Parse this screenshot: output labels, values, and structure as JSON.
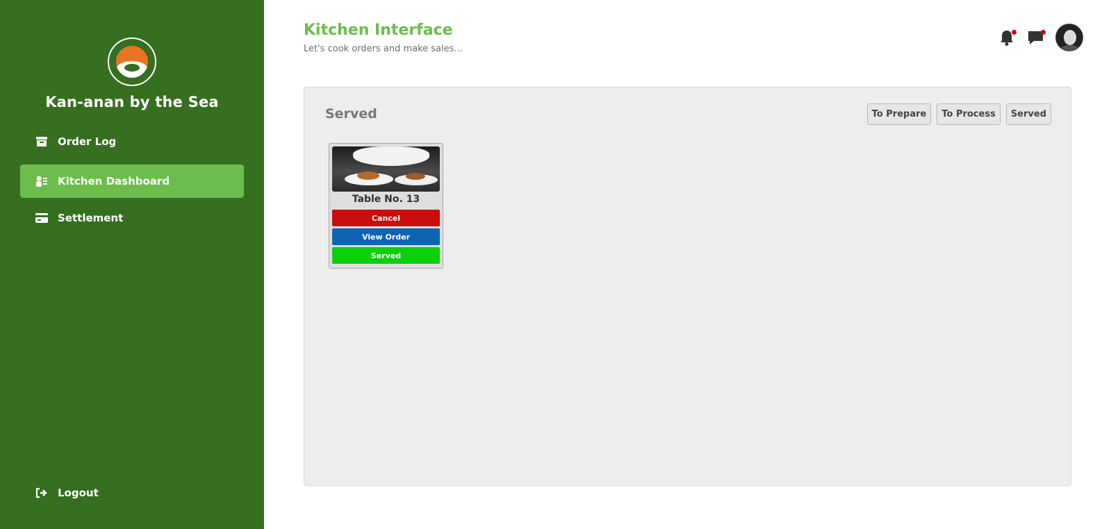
{
  "brand": {
    "name": "Kan-anan by the Sea",
    "logo_icon": "restaurant-logo"
  },
  "sidebar": {
    "items": [
      {
        "label": "Order Log",
        "icon": "archive-icon",
        "active": false
      },
      {
        "label": "Kitchen Dashboard",
        "icon": "chef-list-icon",
        "active": true
      },
      {
        "label": "Settlement",
        "icon": "card-icon",
        "active": false
      }
    ],
    "logout": {
      "label": "Logout",
      "icon": "logout-icon"
    }
  },
  "header": {
    "title": "Kitchen Interface",
    "subtitle": "Let's cook orders and make sales..."
  },
  "panel": {
    "title": "Served",
    "filters": [
      "To Prepare",
      "To Process",
      "Served"
    ]
  },
  "orders": [
    {
      "table": "Table No. 13",
      "actions": {
        "cancel": "Cancel",
        "view": "View Order",
        "served": "Served"
      }
    }
  ],
  "colors": {
    "sidebar_bg": "#356f1f",
    "accent": "#6cbd4c",
    "cancel": "#cc0d0d",
    "view": "#0d63b4",
    "served": "#0ad10a",
    "notification_dot": "#d0021b"
  }
}
